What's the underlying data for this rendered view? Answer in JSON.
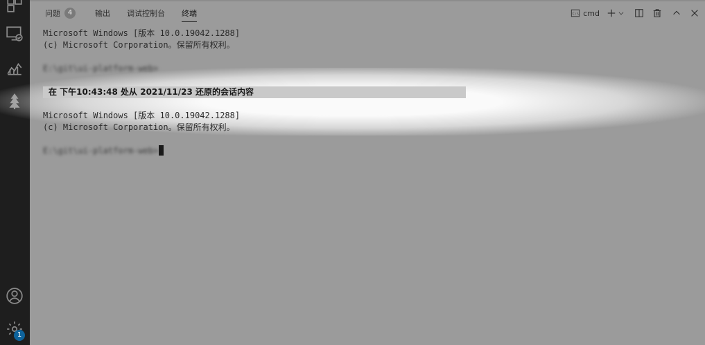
{
  "tabs": [
    {
      "label": "问题",
      "count": "4"
    },
    {
      "label": "输出"
    },
    {
      "label": "调试控制台"
    },
    {
      "label": "终端"
    }
  ],
  "toolbar": {
    "shell": "cmd"
  },
  "terminal": {
    "session1": {
      "line1": "Microsoft Windows [版本 10.0.19042.1288]",
      "line2": "(c) Microsoft Corporation。保留所有权利。",
      "prompt": "E:\\git\\ui-platform-web>"
    },
    "restore_message": "在 下午10:43:48 处从 2021/11/23 还原的会话内容",
    "session2": {
      "line1": "Microsoft Windows [版本 10.0.19042.1288]",
      "line2": "(c) Microsoft Corporation。保留所有权利。",
      "prompt": "E:\\git\\ui-platform-web>"
    }
  },
  "activity": {
    "settings_badge": "1"
  }
}
